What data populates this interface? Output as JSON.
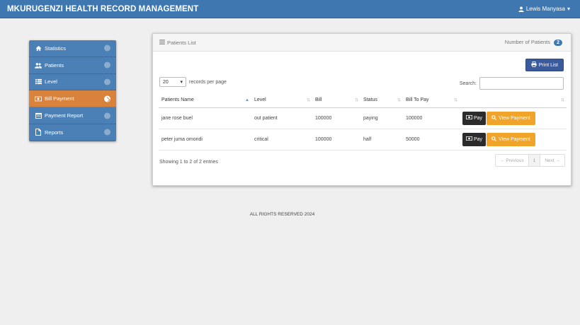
{
  "navbar": {
    "brand": "MKURUGENZI HEALTH RECORD MANAGEMENT",
    "user_name": "Lewis Manyasa",
    "user_icon": "user-icon",
    "caret": "▾"
  },
  "sidebar": {
    "items": [
      {
        "label": "Statistics",
        "icon": "home-icon",
        "active": false
      },
      {
        "label": "Patients",
        "icon": "users-icon",
        "active": false
      },
      {
        "label": "Level",
        "icon": "list-icon",
        "active": false
      },
      {
        "label": "Bill Payment",
        "icon": "money-icon",
        "active": true
      },
      {
        "label": "Payment Report",
        "icon": "calendar-icon",
        "active": false
      },
      {
        "label": "Reports",
        "icon": "file-icon",
        "active": false
      }
    ]
  },
  "panel": {
    "title": "Patients List",
    "count_label": "Number of Patients",
    "count": "2",
    "print_label": "Print List",
    "length_value": "20",
    "length_suffix": "records per page",
    "search_label": "Search:",
    "search_value": "",
    "columns": [
      "Patients Name",
      "Level",
      "Bill",
      "Status",
      "Bill To Pay",
      ""
    ],
    "rows": [
      {
        "name": "jane rose buel",
        "level": "out patient",
        "bill": "100000",
        "status": "paying",
        "to_pay": "100000"
      },
      {
        "name": "peter juma omondi",
        "level": "critical",
        "bill": "100000",
        "status": "half",
        "to_pay": "50000"
      }
    ],
    "pay_label": "Pay",
    "view_label": "View Payment",
    "info": "Showing 1 to 2 of 2 entries",
    "pager": {
      "prev": "← Previous",
      "page": "1",
      "next": "Next →"
    }
  },
  "footer": "ALL RIGHTS RESERVED 2024",
  "colors": {
    "navbar": "#3f78b1",
    "active": "#d9823b",
    "view": "#f0a52a",
    "pay": "#2b2b2b"
  }
}
